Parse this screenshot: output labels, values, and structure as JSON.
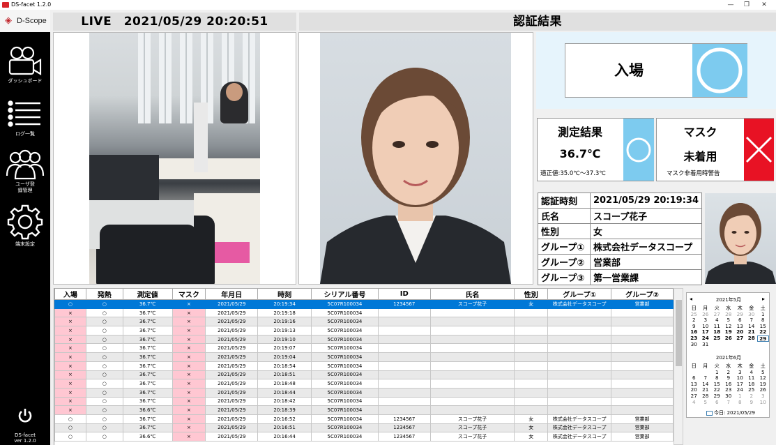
{
  "window": {
    "title": "DS-facet 1.2.0",
    "min": "—",
    "restore": "❐",
    "close": "✕"
  },
  "brand": {
    "name": "D-Scope",
    "logo_color": "#c1272d"
  },
  "sidebar": {
    "items": [
      {
        "label": "ダッシュボード",
        "icon": "camera-icon"
      },
      {
        "label": "ログ一覧",
        "icon": "list-icon"
      },
      {
        "label": "ユーザ登録管理",
        "icon": "users-icon"
      },
      {
        "label": "端末設定",
        "icon": "gear-icon"
      }
    ],
    "power_icon": "power-icon",
    "app_name": "DS-facet",
    "version": "ver 1.2.0"
  },
  "live": {
    "title": "LIVE　2021/05/29 20:20:51"
  },
  "result": {
    "title": "認証結果",
    "entry": "入場",
    "entry_mark": "circle-icon",
    "colors": {
      "ok": "#7dcbef",
      "ng": "#e81224",
      "result_bg": "#e6f4fc"
    }
  },
  "temp": {
    "label": "測定結果",
    "value": "36.7℃",
    "range": "適正値:35.0℃～37.3℃",
    "mark": "circle-icon"
  },
  "mask": {
    "label": "マスク",
    "value": "未着用",
    "note": "マスク非着用時警告",
    "mark": "cross-icon"
  },
  "info": [
    {
      "k": "認証時刻",
      "v": "2021/05/29 20:19:34"
    },
    {
      "k": "氏名",
      "v": "スコープ花子"
    },
    {
      "k": "性別",
      "v": "女"
    },
    {
      "k": "グループ①",
      "v": "株式会社データスコープ"
    },
    {
      "k": "グループ②",
      "v": "営業部"
    },
    {
      "k": "グループ③",
      "v": "第一営業課"
    }
  ],
  "log": {
    "headers": [
      "入場",
      "発熱",
      "測定値",
      "マスク",
      "年月日",
      "時刻",
      "シリアル番号",
      "ID",
      "氏名",
      "性別",
      "グループ①",
      "グループ②"
    ],
    "rows": [
      [
        "○",
        "○",
        "36.7℃",
        "×",
        "2021/05/29",
        "20:19:34",
        "5C07R100034",
        "1234567",
        "スコープ花子",
        "女",
        "株式会社データスコープ",
        "営業部"
      ],
      [
        "×",
        "○",
        "36.7℃",
        "×",
        "2021/05/29",
        "20:19:18",
        "5C07R100034",
        "",
        "",
        "",
        "",
        ""
      ],
      [
        "×",
        "○",
        "36.7℃",
        "×",
        "2021/05/29",
        "20:19:16",
        "5C07R100034",
        "",
        "",
        "",
        "",
        ""
      ],
      [
        "×",
        "○",
        "36.7℃",
        "×",
        "2021/05/29",
        "20:19:13",
        "5C07R100034",
        "",
        "",
        "",
        "",
        ""
      ],
      [
        "×",
        "○",
        "36.7℃",
        "×",
        "2021/05/29",
        "20:19:10",
        "5C07R100034",
        "",
        "",
        "",
        "",
        ""
      ],
      [
        "×",
        "○",
        "36.7℃",
        "×",
        "2021/05/29",
        "20:19:07",
        "5C07R100034",
        "",
        "",
        "",
        "",
        ""
      ],
      [
        "×",
        "○",
        "36.7℃",
        "×",
        "2021/05/29",
        "20:19:04",
        "5C07R100034",
        "",
        "",
        "",
        "",
        ""
      ],
      [
        "×",
        "○",
        "36.7℃",
        "×",
        "2021/05/29",
        "20:18:54",
        "5C07R100034",
        "",
        "",
        "",
        "",
        ""
      ],
      [
        "×",
        "○",
        "36.7℃",
        "×",
        "2021/05/29",
        "20:18:51",
        "5C07R100034",
        "",
        "",
        "",
        "",
        ""
      ],
      [
        "×",
        "○",
        "36.7℃",
        "×",
        "2021/05/29",
        "20:18:48",
        "5C07R100034",
        "",
        "",
        "",
        "",
        ""
      ],
      [
        "×",
        "○",
        "36.7℃",
        "×",
        "2021/05/29",
        "20:18:44",
        "5C07R100034",
        "",
        "",
        "",
        "",
        ""
      ],
      [
        "×",
        "○",
        "36.7℃",
        "×",
        "2021/05/29",
        "20:18:42",
        "5C07R100034",
        "",
        "",
        "",
        "",
        ""
      ],
      [
        "×",
        "○",
        "36.6℃",
        "×",
        "2021/05/29",
        "20:18:39",
        "5C07R100034",
        "",
        "",
        "",
        "",
        ""
      ],
      [
        "○",
        "○",
        "36.7℃",
        "×",
        "2021/05/29",
        "20:16:52",
        "5C07R100034",
        "1234567",
        "スコープ花子",
        "女",
        "株式会社データスコープ",
        "営業部"
      ],
      [
        "○",
        "○",
        "36.7℃",
        "×",
        "2021/05/29",
        "20:16:51",
        "5C07R100034",
        "1234567",
        "スコープ花子",
        "女",
        "株式会社データスコープ",
        "営業部"
      ],
      [
        "○",
        "○",
        "36.6℃",
        "×",
        "2021/05/29",
        "20:16:44",
        "5C07R100034",
        "1234567",
        "スコープ花子",
        "女",
        "株式会社データスコープ",
        "営業部"
      ]
    ]
  },
  "calendar": {
    "prev": "◂",
    "next": "▸",
    "dow": [
      "日",
      "月",
      "火",
      "水",
      "木",
      "金",
      "土"
    ],
    "months": [
      {
        "title": "2021年5月",
        "days": [
          [
            "25",
            "o"
          ],
          [
            "26",
            "o"
          ],
          [
            "27",
            "o"
          ],
          [
            "28",
            "o"
          ],
          [
            "29",
            "o"
          ],
          [
            "30",
            "o"
          ],
          [
            "1",
            ""
          ],
          [
            "2",
            ""
          ],
          [
            "3",
            ""
          ],
          [
            "4",
            ""
          ],
          [
            "5",
            ""
          ],
          [
            "6",
            ""
          ],
          [
            "7",
            ""
          ],
          [
            "8",
            ""
          ],
          [
            "9",
            ""
          ],
          [
            "10",
            ""
          ],
          [
            "11",
            ""
          ],
          [
            "12",
            ""
          ],
          [
            "13",
            ""
          ],
          [
            "14",
            ""
          ],
          [
            "15",
            ""
          ],
          [
            "16",
            "b"
          ],
          [
            "17",
            "b"
          ],
          [
            "18",
            "b"
          ],
          [
            "19",
            "b"
          ],
          [
            "20",
            "b"
          ],
          [
            "21",
            "b"
          ],
          [
            "22",
            "b"
          ],
          [
            "23",
            "b"
          ],
          [
            "24",
            "b"
          ],
          [
            "25",
            "b"
          ],
          [
            "26",
            "b"
          ],
          [
            "27",
            "b"
          ],
          [
            "28",
            "b"
          ],
          [
            "29",
            "t"
          ],
          [
            "30",
            ""
          ],
          [
            "31",
            ""
          ]
        ]
      },
      {
        "title": "2021年6月",
        "days": [
          [
            "",
            "o"
          ],
          [
            "",
            "o"
          ],
          [
            "1",
            ""
          ],
          [
            "2",
            ""
          ],
          [
            "3",
            ""
          ],
          [
            "4",
            ""
          ],
          [
            "5",
            ""
          ],
          [
            "6",
            ""
          ],
          [
            "7",
            ""
          ],
          [
            "8",
            ""
          ],
          [
            "9",
            ""
          ],
          [
            "10",
            ""
          ],
          [
            "11",
            ""
          ],
          [
            "12",
            ""
          ],
          [
            "13",
            ""
          ],
          [
            "14",
            ""
          ],
          [
            "15",
            ""
          ],
          [
            "16",
            ""
          ],
          [
            "17",
            ""
          ],
          [
            "18",
            ""
          ],
          [
            "19",
            ""
          ],
          [
            "20",
            ""
          ],
          [
            "21",
            ""
          ],
          [
            "22",
            ""
          ],
          [
            "23",
            ""
          ],
          [
            "24",
            ""
          ],
          [
            "25",
            ""
          ],
          [
            "26",
            ""
          ],
          [
            "27",
            ""
          ],
          [
            "28",
            ""
          ],
          [
            "29",
            ""
          ],
          [
            "30",
            ""
          ],
          [
            "1",
            "o"
          ],
          [
            "2",
            "o"
          ],
          [
            "3",
            "o"
          ],
          [
            "4",
            "o"
          ],
          [
            "5",
            "o"
          ],
          [
            "6",
            "o"
          ],
          [
            "7",
            "o"
          ],
          [
            "8",
            "o"
          ],
          [
            "9",
            "o"
          ],
          [
            "10",
            "o"
          ]
        ]
      }
    ],
    "today": "今日: 2021/05/29"
  }
}
